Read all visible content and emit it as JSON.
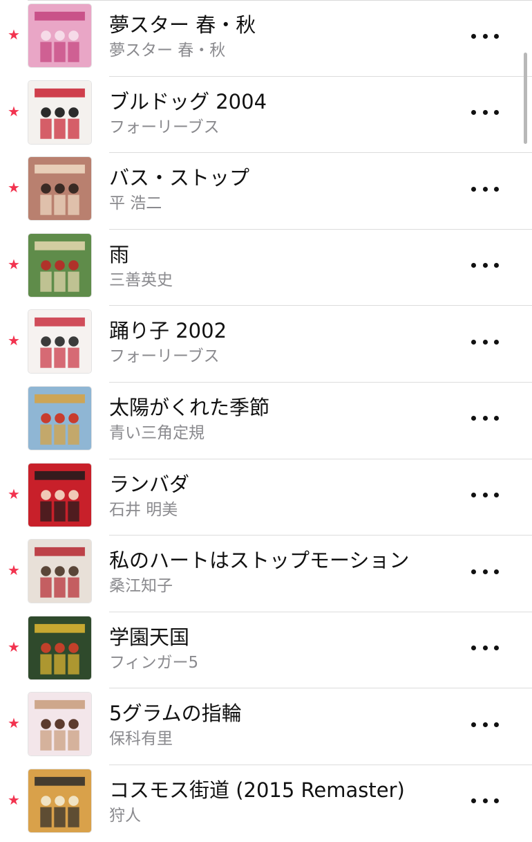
{
  "tracks": [
    {
      "title": "夢スター 春・秋",
      "artist": "夢スター 春・秋",
      "loved": true,
      "art_icon": "album-art-yume-star",
      "colors": [
        "#e9a6c6",
        "#c3437e",
        "#f6dbe8"
      ]
    },
    {
      "title": "ブルドッグ 2004",
      "artist": "フォーリーブス",
      "loved": true,
      "art_icon": "album-art-four-leaves",
      "colors": [
        "#f4f1ee",
        "#c8202f",
        "#2b2b2b"
      ]
    },
    {
      "title": "バス・ストップ",
      "artist": "平 浩二",
      "loved": true,
      "art_icon": "album-art-hira-koji",
      "colors": [
        "#b9806f",
        "#f0dcc5",
        "#3a2a24"
      ]
    },
    {
      "title": "雨",
      "artist": "三善英史",
      "loved": true,
      "art_icon": "album-art-miyoshi-eiji",
      "colors": [
        "#5f8c4a",
        "#e8d8b0",
        "#b0322a"
      ]
    },
    {
      "title": "踊り子 2002",
      "artist": "フォーリーブス",
      "loved": true,
      "art_icon": "album-art-four-leaves-2",
      "colors": [
        "#f6f2f0",
        "#c9303f",
        "#3b3b3b"
      ]
    },
    {
      "title": "太陽がくれた季節",
      "artist": "青い三角定規",
      "loved": false,
      "art_icon": "album-art-aoi-sankaku-jougi",
      "colors": [
        "#8fb6d4",
        "#d8a23f",
        "#c83c2e"
      ]
    },
    {
      "title": "ランバダ",
      "artist": "石井 明美",
      "loved": true,
      "art_icon": "album-art-ishii-akemi",
      "colors": [
        "#c8202a",
        "#1b1b1b",
        "#f0c9b7"
      ]
    },
    {
      "title": "私のハートはストップモーション",
      "artist": "桑江知子",
      "loved": true,
      "art_icon": "album-art-kuwae-tomoko",
      "colors": [
        "#e8e0d8",
        "#b5262f",
        "#5a4638"
      ]
    },
    {
      "title": "学園天国",
      "artist": "フィンガー5",
      "loved": true,
      "art_icon": "album-art-finger5",
      "colors": [
        "#2f4a2c",
        "#e2b832",
        "#c2402a"
      ]
    },
    {
      "title": "5グラムの指輪",
      "artist": "保科有里",
      "loved": true,
      "art_icon": "album-art-hoshina-yuri",
      "colors": [
        "#f3e6ea",
        "#c79b7a",
        "#5c3b2e"
      ]
    },
    {
      "title": "コスモス街道 (2015 Remaster)",
      "artist": "狩人",
      "loved": true,
      "art_icon": "album-art-karyudo",
      "colors": [
        "#d9a14a",
        "#2a2a2a",
        "#f0e3c4"
      ]
    }
  ],
  "star_glyph": "★",
  "accent_color": "#f2334f",
  "more_icon": "ellipsis-icon"
}
